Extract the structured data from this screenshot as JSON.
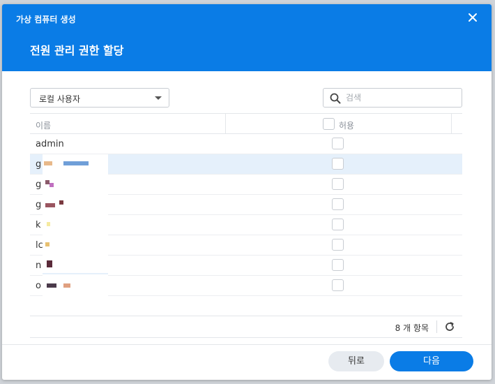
{
  "dialog": {
    "app_title": "가상 컴퓨터 생성",
    "step_title": "전원 관리 권한 할당"
  },
  "toolbar": {
    "user_type_selected": "로컬 사용자",
    "search_placeholder": "검색"
  },
  "grid": {
    "columns": {
      "name": "이름",
      "allow": "허용"
    },
    "rows": [
      {
        "name": "admin",
        "allowed": false,
        "selected": false
      },
      {
        "name": "g",
        "allowed": false,
        "selected": true
      },
      {
        "name": "g",
        "allowed": false,
        "selected": false
      },
      {
        "name": "g",
        "allowed": false,
        "selected": false
      },
      {
        "name": "k",
        "allowed": false,
        "selected": false
      },
      {
        "name": "lc",
        "allowed": false,
        "selected": false
      },
      {
        "name": "n",
        "allowed": false,
        "selected": false
      },
      {
        "name": "o",
        "allowed": false,
        "selected": false
      }
    ]
  },
  "footer": {
    "item_count": "8 개 항목"
  },
  "buttons": {
    "back": "뒤로",
    "next": "다음"
  },
  "colors": {
    "accent": "#0a7ce6",
    "selected_row": "#e5f0fb"
  },
  "icons": {
    "close": "close-icon",
    "dropdown": "chevron-down-icon",
    "search": "search-icon",
    "refresh": "refresh-icon"
  }
}
